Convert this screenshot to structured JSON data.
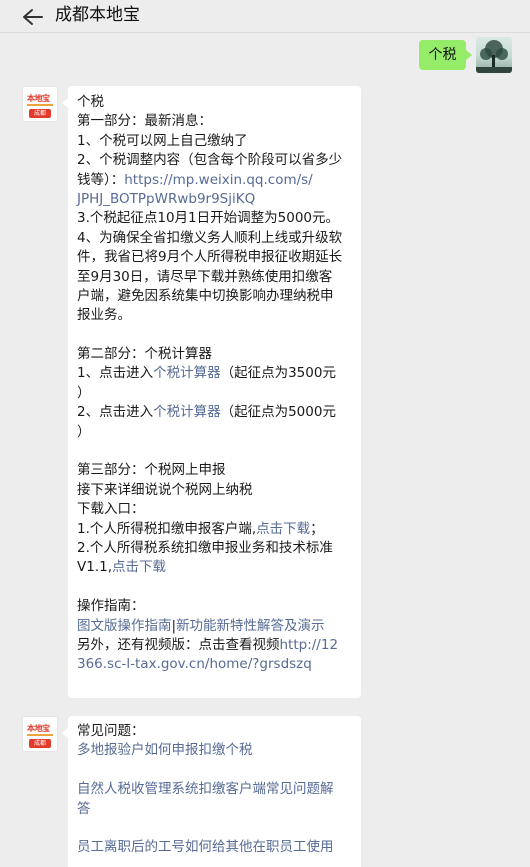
{
  "header": {
    "title": "成都本地宝"
  },
  "self_message": {
    "text": "个税"
  },
  "avatar_logo": {
    "top": "本地宝",
    "bottom": "成都"
  },
  "message1": {
    "heading": "个税",
    "part1_title": "第一部分：最新消息：",
    "p1_item1": "1、个税可以网上自己缴纳了",
    "p1_item2_a": "2、个税调整内容（包含每个阶段可以省多少",
    "p1_item2_b": "钱等）：",
    "p1_link1_a": "https://mp.weixin.qq.com/s/",
    "p1_link1_b": "JPHJ_BOTPpWRwb9r9SjiKQ",
    "p1_item3": "3.个税起征点10月1日开始调整为5000元。",
    "p1_item4_a": "4、为确保全省扣缴义务人顺利上线或升级软",
    "p1_item4_b": "件，我省已将9月个人所得税申报征收期延长",
    "p1_item4_c": "至9月30日，请尽早下载并熟练使用扣缴客",
    "p1_item4_d": "户端，避免因系统集中切换影响办理纳税申",
    "p1_item4_e": "报业务。",
    "part2_title": "第二部分：个税计算器",
    "p2_item1_pre": "1、点击进入",
    "p2_item1_link": "个税计算器",
    "p2_item1_post": "（起征点为3500元",
    "p2_item1_end": "）",
    "p2_item2_pre": "2、点击进入",
    "p2_item2_link": "个税计算器",
    "p2_item2_post": "（起征点为5000元",
    "p2_item2_end": "）",
    "part3_title": "第三部分：个税网上申报",
    "p3_intro": "接下来详细说说个税网上纳税",
    "p3_download": "下载入口：",
    "p3_dl1_pre": "1.个人所得税扣缴申报客户端,",
    "p3_dl1_link": "点击下载",
    "p3_dl1_post": "；",
    "p3_dl2_a": "2.个人所得税系统扣缴申报业务和技术标准",
    "p3_dl2_pre": "V1.1,",
    "p3_dl2_link": "点击下载",
    "guide_title": "操作指南：",
    "guide_link1": "图文版操作指南",
    "guide_sep": "|",
    "guide_link2": "新功能新特性解答及演示",
    "video_pre": "另外，还有视频版：点击查看视频",
    "video_link_a": "http://12",
    "video_link_b": "366.sc-l-tax.gov.cn/home/?grsdszq"
  },
  "message2": {
    "heading": "常见问题：",
    "faq1": "多地报验户如何申报扣缴个税",
    "faq2_a": "自然人税收管理系统扣缴客户端常见问题解",
    "faq2_b": "答",
    "faq3": "员工离职后的工号如何给其他在职员工使用"
  }
}
